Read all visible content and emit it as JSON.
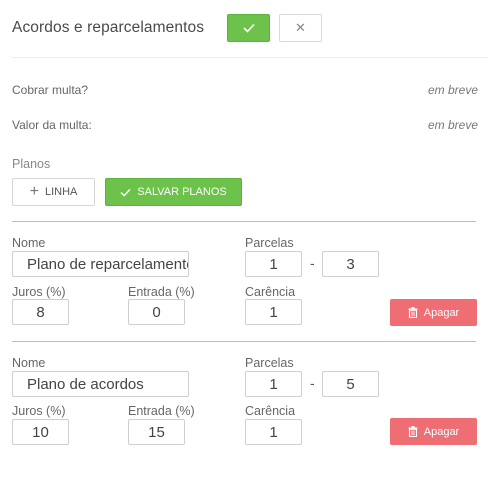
{
  "header": {
    "title": "Acordos e reparcelamentos",
    "confirm_icon": "check-icon",
    "cancel_icon": "close-icon",
    "cancel_glyph": "✕"
  },
  "options": [
    {
      "label": "Cobrar multa?",
      "value": "em breve"
    },
    {
      "label": "Valor da multa:",
      "value": "em breve"
    }
  ],
  "planos": {
    "label": "Planos",
    "add_button": "LINHA",
    "add_glyph": "+",
    "save_button": "SALVAR PLANOS"
  },
  "field_labels": {
    "nome": "Nome",
    "parcelas": "Parcelas",
    "juros": "Juros (%)",
    "entrada": "Entrada (%)",
    "carencia": "Carência"
  },
  "plans": [
    {
      "nome": "Plano de reparcelamento",
      "parcelas_min": "1",
      "parcelas_max": "3",
      "juros": "8",
      "entrada": "0",
      "carencia": "1",
      "delete_label": "Apagar"
    },
    {
      "nome": "Plano de acordos",
      "parcelas_min": "1",
      "parcelas_max": "5",
      "juros": "10",
      "entrada": "15",
      "carencia": "1",
      "delete_label": "Apagar"
    }
  ],
  "range_separator": "-",
  "colors": {
    "primary_green": "#6cc24a",
    "danger_red": "#ef6e73"
  }
}
